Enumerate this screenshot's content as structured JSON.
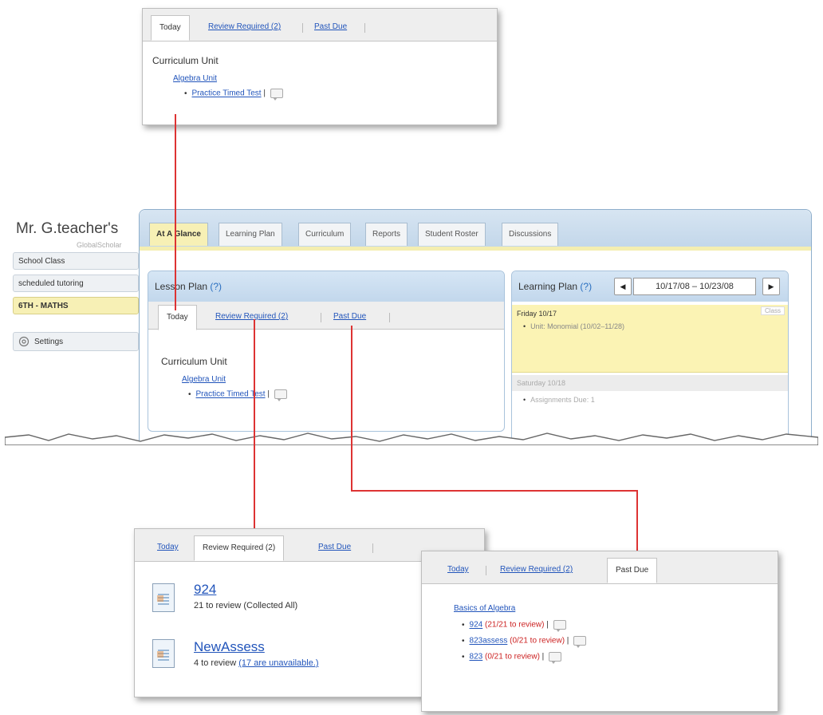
{
  "top_callout": {
    "tabs": [
      "Today",
      "Review Required (2)",
      "Past Due"
    ],
    "section": "Curriculum Unit",
    "unit_link": "Algebra Unit",
    "item_link": "Practice Timed Test"
  },
  "app": {
    "teacher_name": "Mr. G.teacher's",
    "brand": "GlobalScholar",
    "sidebar": {
      "items": [
        "School Class",
        "scheduled tutoring",
        "6TH - MATHS"
      ],
      "settings": "Settings",
      "settings_icon": "gear-icon"
    },
    "tabs": [
      "At A Glance",
      "Learning Plan",
      "Curriculum",
      "Reports",
      "Student Roster",
      "Discussions"
    ],
    "lesson_plan": {
      "title": "Lesson Plan",
      "help": "(?)",
      "tabs": [
        "Today",
        "Review Required (2)",
        "Past Due"
      ],
      "section": "Curriculum Unit",
      "unit_link": "Algebra Unit",
      "item_link": "Practice Timed Test"
    },
    "learning_plan": {
      "title": "Learning Plan",
      "help": "(?)",
      "date_range": "10/17/08 – 10/23/08",
      "prev_icon": "triangle-left-icon",
      "next_icon": "triangle-right-icon",
      "days": [
        {
          "label": "Friday 10/17",
          "badge": "Class",
          "item": "Unit: Monomial (10/02–11/28)"
        },
        {
          "label": "Saturday 10/18",
          "item": "Assignments Due: 1"
        }
      ]
    }
  },
  "review_callout": {
    "tabs": [
      "Today",
      "Review Required (2)",
      "Past Due"
    ],
    "items": [
      {
        "title": "924",
        "detail": "21 to review (Collected All)"
      },
      {
        "title": "NewAssess",
        "detail": "4 to review",
        "link": "(17 are unavailable.)"
      }
    ]
  },
  "pastdue_callout": {
    "tabs": [
      "Today",
      "Review Required (2)",
      "Past Due"
    ],
    "section_link": "Basics of Algebra",
    "items": [
      {
        "link": "924",
        "status": "(21/21 to review)"
      },
      {
        "link": "823assess",
        "status": "(0/21 to review)"
      },
      {
        "link": "823",
        "status": "(0/21 to review)"
      }
    ]
  },
  "colors": {
    "accent_blue": "#c3d7ea",
    "active_yellow": "#f7f0b5",
    "connector_red": "#dd3333",
    "link_blue": "#2255bb"
  }
}
